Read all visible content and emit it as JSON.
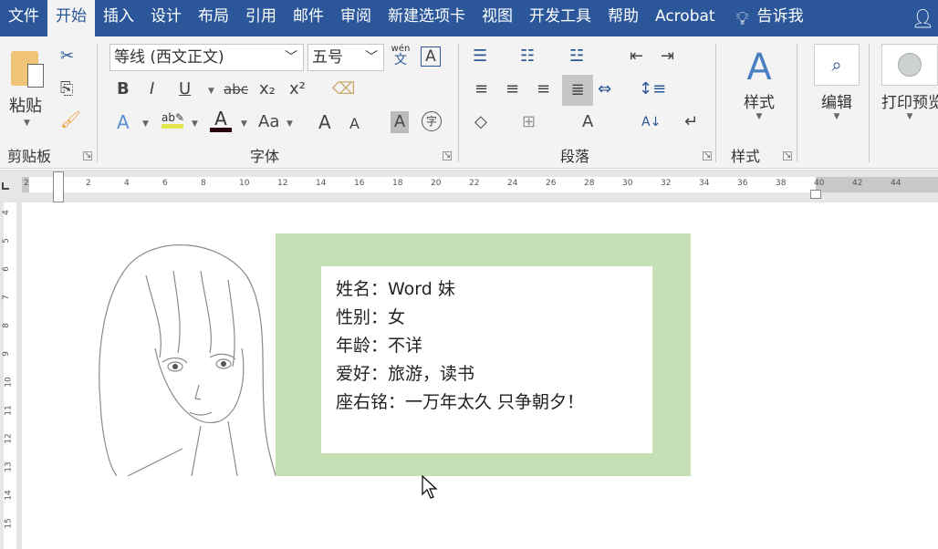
{
  "tabs": [
    "文件",
    "开始",
    "插入",
    "设计",
    "布局",
    "引用",
    "邮件",
    "审阅",
    "新建选项卡",
    "视图",
    "开发工具",
    "帮助",
    "Acrobat"
  ],
  "active_tab": "开始",
  "tell_me": "告诉我",
  "ribbon": {
    "clipboard": {
      "paste": "粘贴",
      "label": "剪贴板"
    },
    "font": {
      "name": "等线 (西文正文)",
      "size": "五号",
      "label": "字体",
      "pinyin_top": "wén",
      "pinyin_bottom": "文",
      "bold": "B",
      "italic": "I",
      "underline": "U",
      "strike": "abc",
      "sub": "x₂",
      "sup": "x²",
      "case": "Aa",
      "grow": "A",
      "shrink": "A",
      "shade": "A",
      "enclose": "字",
      "color": "A",
      "highlight_color": "#e2e64a",
      "font_color": "#2a0010"
    },
    "paragraph": {
      "label": "段落"
    },
    "styles": {
      "button": "样式",
      "label": "样式"
    },
    "editing": {
      "button": "编辑"
    },
    "print": {
      "button": "打印预览"
    }
  },
  "ruler": {
    "ticks": [
      "2",
      "2",
      "4",
      "6",
      "8",
      "10",
      "12",
      "14",
      "16",
      "18",
      "20",
      "22",
      "24",
      "26",
      "28",
      "30",
      "32",
      "34",
      "36",
      "38",
      "40",
      "42",
      "44"
    ],
    "vticks": [
      "4",
      "5",
      "6",
      "7",
      "8",
      "9",
      "10",
      "11",
      "12",
      "13",
      "14",
      "15"
    ]
  },
  "document": {
    "lines": [
      "姓名：Word 妹",
      "性别：女",
      "年龄：不详",
      "爱好：旅游，读书",
      "座右铭：一万年太久  只争朝夕！"
    ],
    "box_color": "#c5e0b4"
  },
  "colors": {
    "accent": "#2b579a",
    "ribbon": "#f3f3f3"
  }
}
